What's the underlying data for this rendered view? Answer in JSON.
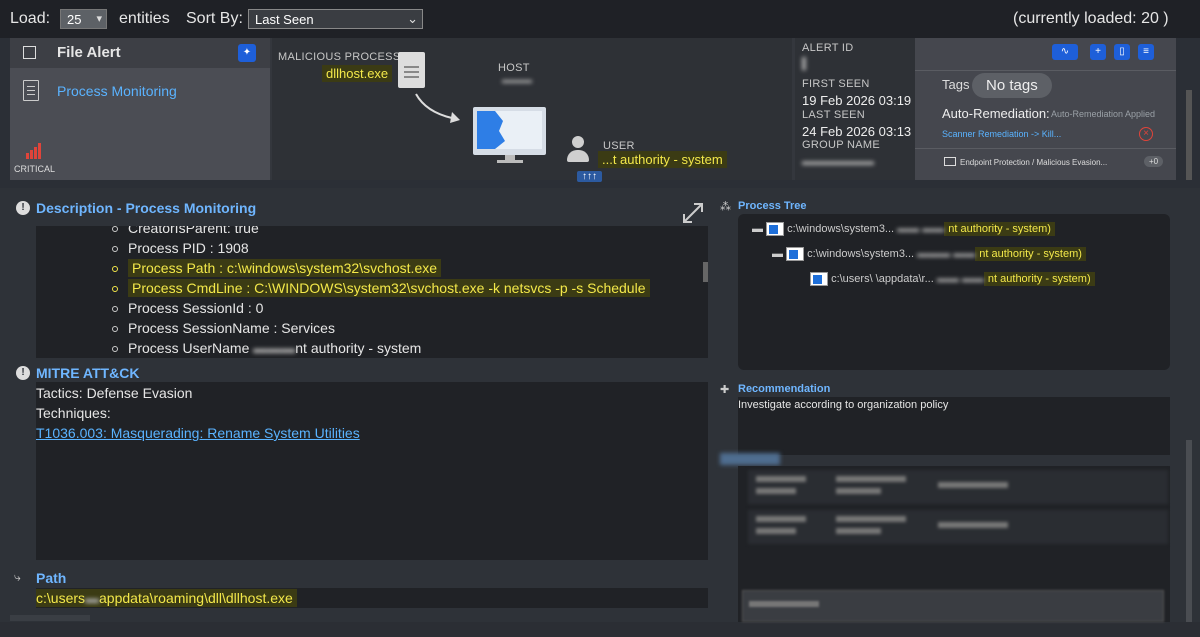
{
  "toolbar": {
    "load_label": "Load:",
    "load_value": "25",
    "entities_label": "entities",
    "sort_label": "Sort By:",
    "sort_value": "Last Seen",
    "loaded_status": "(currently loaded: 20 )"
  },
  "alert": {
    "title": "File Alert",
    "source": "Process Monitoring",
    "severity": "CRITICAL",
    "malicious_process_label": "MALICIOUS PROCESS",
    "malicious_process_value": "dllhost.exe",
    "host_label": "HOST",
    "user_label": "USER",
    "user_value": "...t authority - system",
    "arrows_badge": "↑↑↑",
    "alert_id_label": "ALERT ID",
    "first_seen_label": "FIRST SEEN",
    "first_seen_value": "19 Feb 2026 03:19",
    "last_seen_label": "LAST SEEN",
    "last_seen_value": "24 Feb 2026 03:13",
    "group_name_label": "GROUP NAME",
    "tags_label": "Tags",
    "tags_value": "No tags",
    "auto_remediation_label": "Auto-Remediation:",
    "auto_remediation_status": "Auto-Remediation Applied",
    "remediation_link": "Scanner Remediation -> Kill...",
    "endpoint_label": "Endpoint Protection / Malicious Evasion...",
    "endpoint_badge": "+0"
  },
  "description": {
    "title": "Description - Process Monitoring",
    "lines": [
      {
        "text": "CreatorIsParent: true",
        "highlight": false
      },
      {
        "text": "Process PID : 1908",
        "highlight": false
      },
      {
        "text": "Process Path : c:\\windows\\system32\\svchost.exe",
        "highlight": true
      },
      {
        "text": "Process CmdLine : C:\\WINDOWS\\system32\\svchost.exe -k netsvcs -p -s Schedule",
        "highlight": true
      },
      {
        "text": "Process SessionId : 0",
        "highlight": false
      },
      {
        "text": "Process SessionName : Services",
        "highlight": false
      },
      {
        "text": "Process UserName",
        "highlight": false,
        "suffix": "nt authority - system"
      }
    ]
  },
  "mitre": {
    "title": "MITRE ATT&CK",
    "tactics": "Tactics: Defense Evasion",
    "techniques_label": "Techniques:",
    "technique_link": "T1036.003: Masquerading: Rename System Utilities"
  },
  "path": {
    "title": "Path",
    "value": "c:\\users\\    \\appdata\\roaming\\dll\\dllhost.exe",
    "prefix": "c:\\users",
    "suffix": "appdata\\roaming\\dll\\dllhost.exe"
  },
  "process_tree": {
    "title": "Process Tree",
    "nodes": [
      {
        "path": "c:\\windows\\system3...",
        "user": "nt authority - system)"
      },
      {
        "path": "c:\\windows\\system3...",
        "user": "nt authority - system)"
      },
      {
        "path": "c:\\users\\   \\appdata\\r...",
        "user": "nt authority - system)"
      }
    ]
  },
  "recommendation": {
    "title": "Recommendation",
    "text": "Investigate according to organization policy"
  },
  "colors": {
    "accent": "#5ab3ff",
    "highlight_text": "#f3e84a",
    "highlight_bg": "#3b3b14",
    "critical": "#e0443a",
    "button_blue": "#1e5fd9"
  }
}
